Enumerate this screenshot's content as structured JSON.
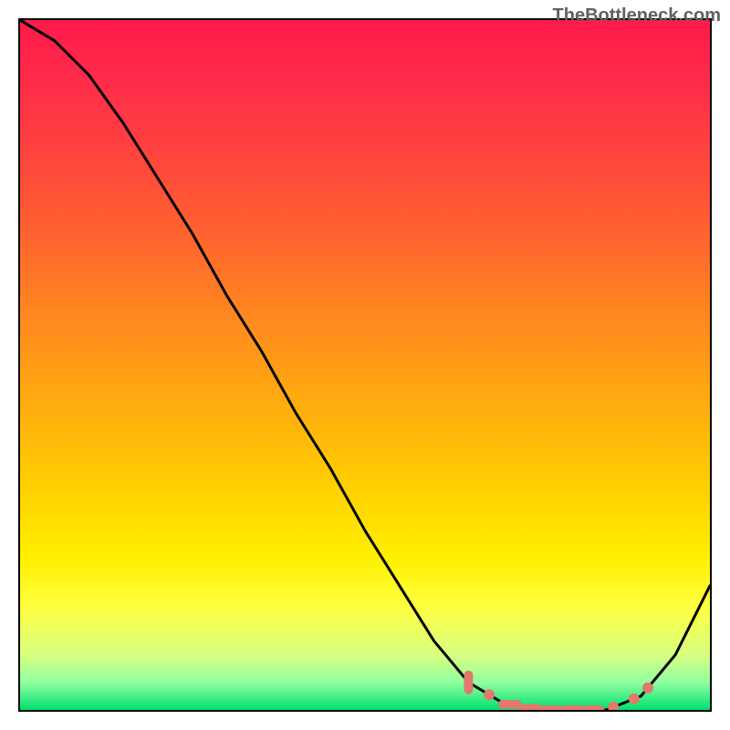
{
  "attribution": "TheBottleneck.com",
  "chart_data": {
    "type": "line",
    "title": "",
    "xlabel": "",
    "ylabel": "",
    "x": [
      0.0,
      0.05,
      0.1,
      0.15,
      0.2,
      0.25,
      0.3,
      0.35,
      0.4,
      0.45,
      0.5,
      0.55,
      0.6,
      0.65,
      0.7,
      0.75,
      0.8,
      0.85,
      0.9,
      0.95,
      1.0
    ],
    "values": [
      1.0,
      0.97,
      0.92,
      0.85,
      0.77,
      0.69,
      0.6,
      0.52,
      0.43,
      0.35,
      0.26,
      0.18,
      0.1,
      0.04,
      0.01,
      0.0,
      0.0,
      0.0,
      0.02,
      0.08,
      0.18
    ],
    "xlim": [
      0,
      1
    ],
    "ylim": [
      0,
      1
    ],
    "markers": [
      {
        "x": 0.65,
        "shape": "vbar"
      },
      {
        "x": 0.68,
        "shape": "dot"
      },
      {
        "x": 0.71,
        "shape": "hbar"
      },
      {
        "x": 0.74,
        "shape": "hbar"
      },
      {
        "x": 0.77,
        "shape": "hbar"
      },
      {
        "x": 0.8,
        "shape": "hbar"
      },
      {
        "x": 0.83,
        "shape": "hbar"
      },
      {
        "x": 0.86,
        "shape": "dot"
      },
      {
        "x": 0.89,
        "shape": "dot"
      },
      {
        "x": 0.91,
        "shape": "dot"
      }
    ],
    "background": "red-yellow-green vertical gradient"
  }
}
